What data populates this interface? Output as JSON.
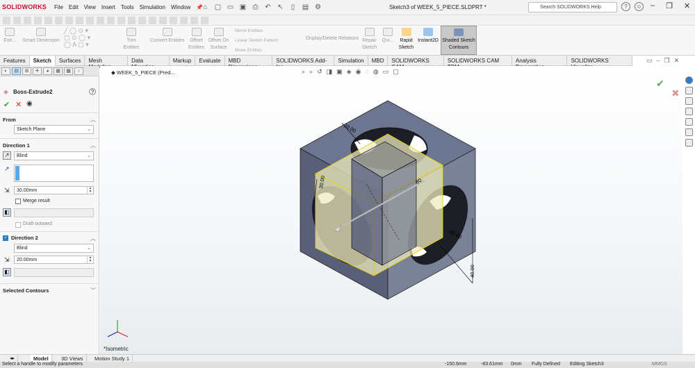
{
  "app": {
    "brand": "SOLIDWORKS",
    "window_title": "Sketch3 of WEEK_5_PIECE.SLDPRT *"
  },
  "menu": [
    "File",
    "Edit",
    "View",
    "Insert",
    "Tools",
    "Simulation",
    "Window"
  ],
  "search": {
    "placeholder": "Search SOLIDWORKS Help"
  },
  "ribbon": {
    "exit": "Exit...",
    "smart_dim": "Smart Dimension",
    "trim": "Trim Entities",
    "convert": "Convert Entities",
    "offset": "Offset\nEntities",
    "offset_surface": "Offset On\nSurface",
    "mirror": "Mirror Entities",
    "linear": "Linear Sketch Pattern",
    "move": "Move Entities",
    "display_delete": "Display/Delete Relations",
    "repair": "Repair\nSketch",
    "quick": "Qui...",
    "rapid": "Rapid\nSketch",
    "instant2d": "Instant2D",
    "shaded": "Shaded Sketch\nContours"
  },
  "tabs": [
    "Features",
    "Sketch",
    "Surfaces",
    "Mesh Modeling",
    "Data Migration",
    "Markup",
    "Evaluate",
    "MBD Dimensions",
    "SOLIDWORKS Add-Ins",
    "Simulation",
    "MBD",
    "SOLIDWORKS CAM",
    "SOLIDWORKS CAM TBM",
    "Analysis Preparation",
    "SOLIDWORKS Visualize"
  ],
  "active_tab": "Sketch",
  "feature": {
    "title": "Boss-Extrude2",
    "from_label": "From",
    "from_value": "Sketch Plane",
    "dir1_label": "Direction 1",
    "dir1_type": "Blind",
    "dir1_depth": "30.00mm",
    "merge_result": "Merge result",
    "draft_outward": "Draft outward",
    "dir2_label": "Direction 2",
    "dir2_type": "Blind",
    "dir2_depth": "20.00mm",
    "selected_contours": "Selected Contours"
  },
  "tree": {
    "item": "WEEK_5_PIECE (Pred..."
  },
  "view_label": "*Isometric",
  "dims": [
    "20.00",
    "30.00",
    "80",
    "40.00",
    "40.00"
  ],
  "bottom_tabs": [
    "Model",
    "3D Views",
    "Motion Study 1"
  ],
  "status": {
    "message": "Select a handle to modify parameters",
    "x": "-150.6mm",
    "y": "-83.61mm",
    "z": "0mm",
    "state": "Fully Defined",
    "mode": "Editing Sketch3",
    "units": "MMGS"
  }
}
